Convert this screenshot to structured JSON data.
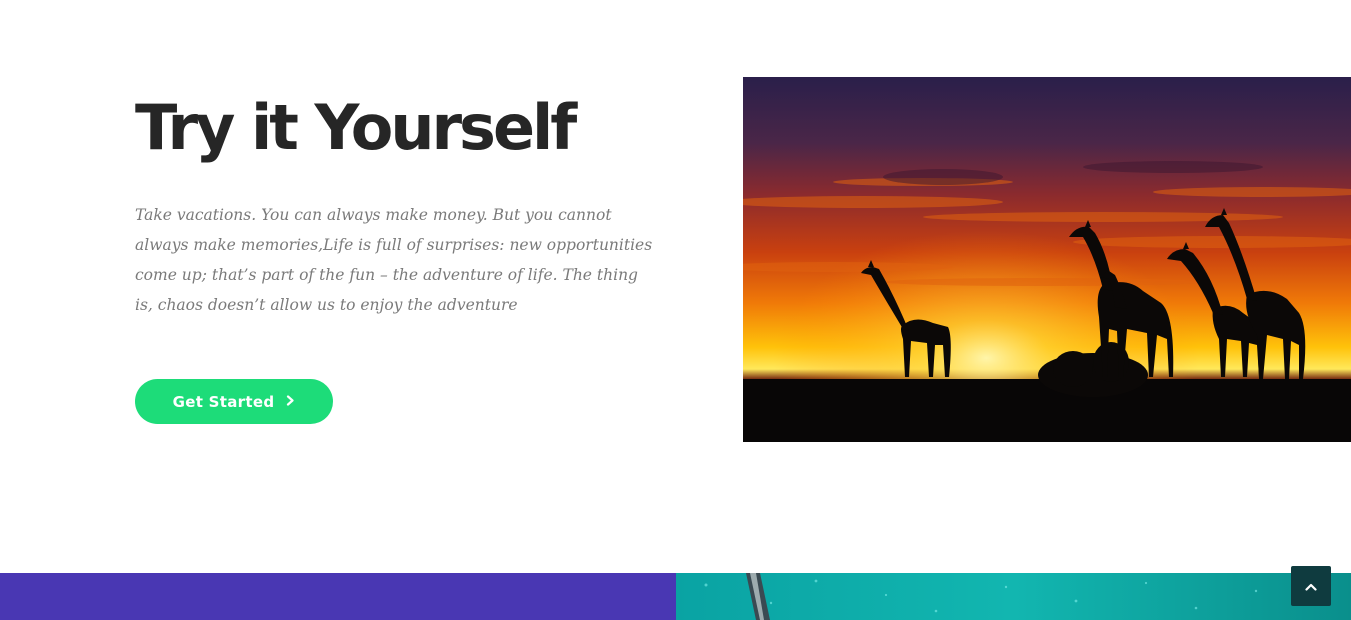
{
  "hero": {
    "title": "Try it Yourself",
    "body": "Take vacations. You can always make money. But you cannot always make memories,Life is full of surprises: new opportunities come up; that’s part of the fun – the adventure of life. The thing is, chaos doesn’t allow us to enjoy the adventure",
    "cta_label": "Get Started",
    "cta_icon": "chevron-right-icon"
  },
  "image": {
    "subject": "giraffes-at-sunset"
  },
  "band": {
    "left_color": "#4937b3",
    "right_subject": "turquoise-water-photo"
  },
  "scroll_top": {
    "icon": "chevron-up-icon"
  },
  "colors": {
    "heading": "#262626",
    "body_text": "#7a7a7a",
    "accent_green": "#1ddc79",
    "scroll_button": "#0f3b3f"
  }
}
